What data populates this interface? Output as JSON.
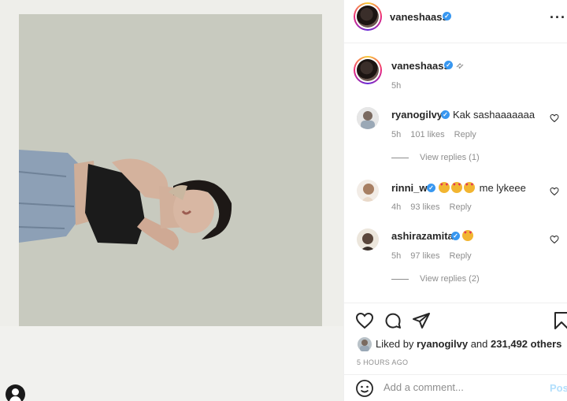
{
  "post": {
    "author": "vaneshaass",
    "caption_time": "5h"
  },
  "comments": [
    {
      "user": "ryanogilvy",
      "text": "Kak sashaaaaaaa",
      "time": "5h",
      "likes": "101 likes",
      "reply": "Reply",
      "view_replies": "View replies (1)"
    },
    {
      "user": "rinni_w",
      "text": "me lykeee",
      "time": "4h",
      "likes": "93 likes",
      "reply": "Reply"
    },
    {
      "user": "ashirazamita",
      "text": "",
      "time": "5h",
      "likes": "97 likes",
      "reply": "Reply",
      "view_replies": "View replies (2)"
    }
  ],
  "footer": {
    "liked_by_prefix": "Liked by",
    "liked_by_user": "ryanogilvy",
    "liked_by_and": "and",
    "liked_by_count": "231,492 others",
    "time_ago": "5 HOURS AGO",
    "comment_placeholder": "Add a comment...",
    "post_label": "Post"
  },
  "icons": [
    "more-icon",
    "link-icon",
    "heart-icon",
    "comment-icon",
    "share-icon",
    "save-icon",
    "emoji-icon",
    "verified-icon"
  ],
  "colors": {
    "verified": "#3897f0",
    "muted": "#8e8e8e",
    "post_button": "#b2dffc"
  }
}
